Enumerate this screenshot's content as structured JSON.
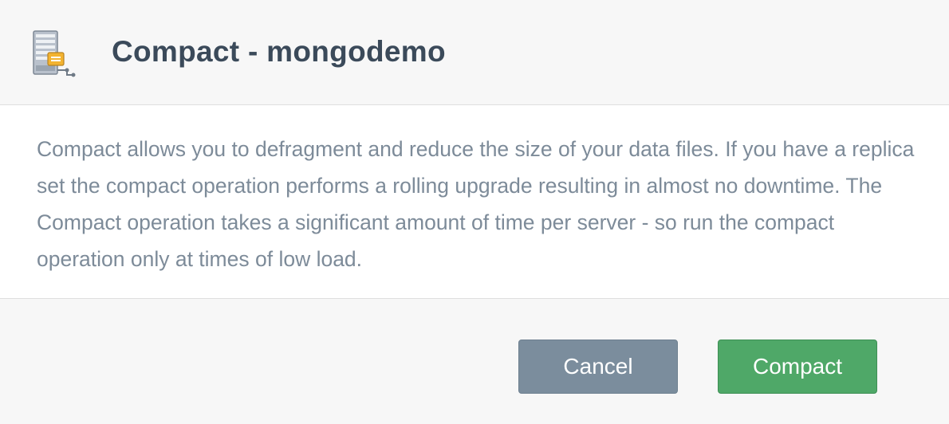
{
  "dialog": {
    "icon": "server-compact-icon",
    "title": "Compact - mongodemo",
    "description": "Compact allows you to defragment and reduce the size of your data files. If you have a replica set the compact operation performs a rolling upgrade resulting in almost no downtime. The Compact operation takes a significant amount of time per server - so run the compact operation only at times of low load.",
    "buttons": {
      "cancel": "Cancel",
      "confirm": "Compact"
    }
  },
  "colors": {
    "cancel_button": "#7b8d9d",
    "confirm_button": "#4fa868",
    "title_text": "#3b4a5a",
    "body_text": "#7d8b99"
  }
}
